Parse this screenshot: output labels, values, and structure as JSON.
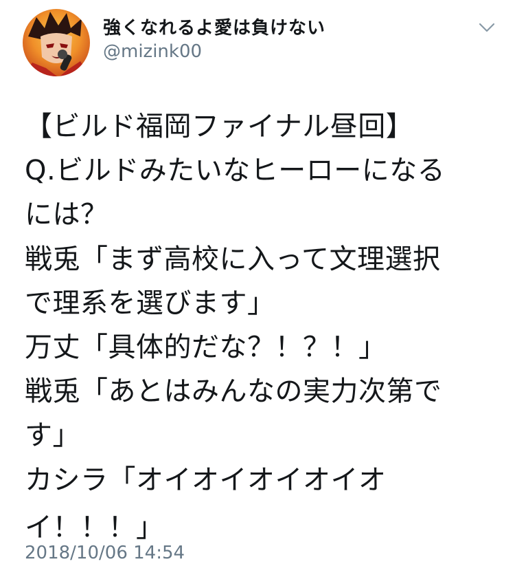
{
  "author": {
    "display_name": "強くなれるよ愛は負けない",
    "handle": "@mizink00",
    "avatar_icon": "avatar-icon"
  },
  "menu_icon": "chevron-down-icon",
  "tweet": {
    "lines": [
      "【ビルド福岡ファイナル昼回】",
      "Q.ビルドみたいなヒーローになる",
      "には？",
      "戦兎「まず高校に入って文理選択",
      "で理系を選びます」",
      "万丈「具体的だな？！？！」",
      "戦兎「あとはみんなの実力次第で",
      "す」",
      "カシラ「オイオイオイオイオ",
      "イ！！！」"
    ],
    "timestamp": "2018/10/06 14:54"
  },
  "colors": {
    "text": "#14171a",
    "secondary": "#657786",
    "background": "#ffffff"
  }
}
